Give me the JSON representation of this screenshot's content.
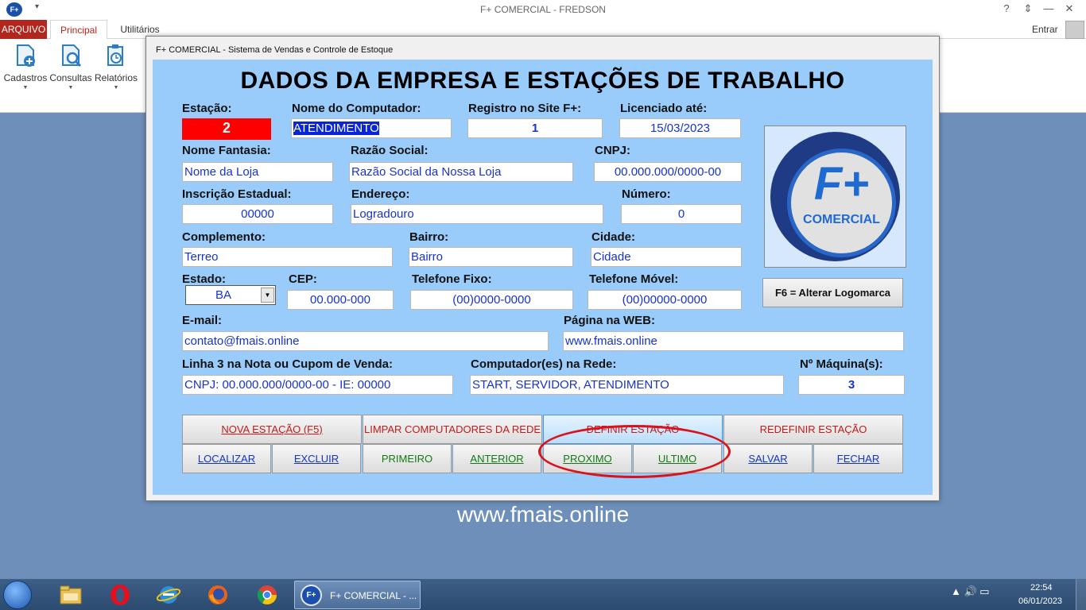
{
  "window": {
    "title": "F+ COMERCIAL - FREDSON",
    "app_icon": "F+",
    "quick_access": "▾",
    "help": "?",
    "ribbon_toggle": "⇕",
    "minimize": "—",
    "restore": "❐",
    "close": "✕"
  },
  "ribbon": {
    "tabs": [
      "ARQUIVO",
      "Principal",
      "Utilitários"
    ],
    "signin": "Entrar",
    "buttons": [
      {
        "label": "Cadastros",
        "icon": "document-add-icon"
      },
      {
        "label": "Consultas",
        "icon": "document-search-icon"
      },
      {
        "label": "Relatórios",
        "icon": "report-clock-icon"
      }
    ],
    "dropdown_glyph": "▼"
  },
  "dialog": {
    "title": "F+ COMERCIAL - Sistema de Vendas e Controle de Estoque",
    "heading": "DADOS DA EMPRESA E ESTAÇÕES DE TRABALHO",
    "fields": {
      "estacao": {
        "label": "Estação:",
        "value": "2"
      },
      "nome_computador": {
        "label": "Nome do Computador:",
        "value": "ATENDIMENTO"
      },
      "registro": {
        "label": "Registro no Site F+:",
        "value": "1"
      },
      "licenciado": {
        "label": "Licenciado até:",
        "value": "15/03/2023"
      },
      "nome_fantasia": {
        "label": "Nome Fantasia:",
        "value": "Nome da Loja"
      },
      "razao_social": {
        "label": "Razão Social:",
        "value": "Razão Social da Nossa Loja"
      },
      "cnpj": {
        "label": "CNPJ:",
        "value": "00.000.000/0000-00"
      },
      "inscricao_estadual": {
        "label": "Inscrição Estadual:",
        "value": "00000"
      },
      "endereco": {
        "label": "Endereço:",
        "value": "Logradouro"
      },
      "numero": {
        "label": "Número:",
        "value": "0"
      },
      "complemento": {
        "label": "Complemento:",
        "value": "Terreo"
      },
      "bairro": {
        "label": "Bairro:",
        "value": "Bairro"
      },
      "cidade": {
        "label": "Cidade:",
        "value": "Cidade"
      },
      "estado": {
        "label": "Estado:",
        "value": "BA"
      },
      "cep": {
        "label": "CEP:",
        "value": "00.000-000"
      },
      "telefone_fixo": {
        "label": "Telefone Fixo:",
        "value": "(00)0000-0000"
      },
      "telefone_movel": {
        "label": "Telefone Móvel:",
        "value": "(00)00000-0000"
      },
      "email": {
        "label": "E-mail:",
        "value": "contato@fmais.online"
      },
      "pagina_web": {
        "label": "Página na WEB:",
        "value": "www.fmais.online"
      },
      "linha3": {
        "label": "Linha 3 na Nota ou Cupom de Venda:",
        "value": "CNPJ: 00.000.000/0000-00 - IE: 00000"
      },
      "computadores_rede": {
        "label": "Computador(es) na Rede:",
        "value": "START, SERVIDOR, ATENDIMENTO"
      },
      "num_maquinas": {
        "label": "Nº Máquina(s):",
        "value": "3"
      }
    },
    "logo": {
      "big": "F+",
      "small": "COMERCIAL"
    },
    "logo_button": "F6 = Alterar Logomarca",
    "actions_row1": [
      "NOVA ESTAÇÃO (F5)",
      "LIMPAR COMPUTADORES DA REDE",
      "DEFINIR ESTAÇÃO",
      "REDEFINIR ESTAÇÃO"
    ],
    "actions_row2": [
      "LOCALIZAR",
      "EXCLUIR",
      "PRIMEIRO",
      "ANTERIOR",
      "PROXIMO",
      "ULTIMO",
      "SALVAR",
      "FECHAR"
    ]
  },
  "watermark": "www.fmais.online",
  "taskbar": {
    "active_app": "F+ COMERCIAL - ...",
    "active_app_icon": "F+",
    "pinned": [
      "file-explorer-icon",
      "opera-icon",
      "internet-explorer-icon",
      "firefox-icon",
      "chrome-icon"
    ],
    "tray": "▲ 🔊 ▭",
    "time": "22:54",
    "date": "06/01/2023"
  },
  "colors": {
    "accent": "#b3261e",
    "form_bg": "#99ccfb",
    "field_text": "#1833c9",
    "estacao_bg": "#ff0000",
    "annotation": "#d9121b"
  }
}
